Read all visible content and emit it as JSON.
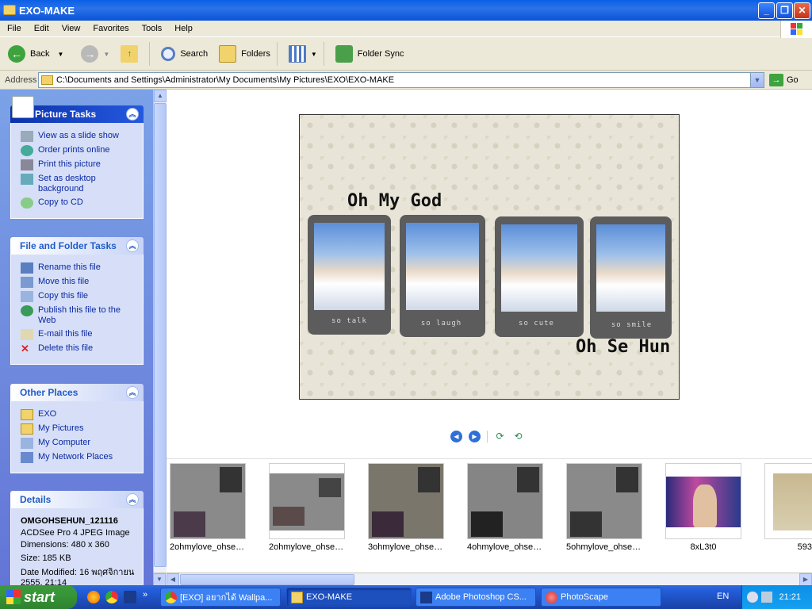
{
  "window": {
    "title": "EXO-MAKE"
  },
  "menu": [
    "File",
    "Edit",
    "View",
    "Favorites",
    "Tools",
    "Help"
  ],
  "toolbar": {
    "back": "Back",
    "search": "Search",
    "folders": "Folders",
    "folder_sync": "Folder Sync"
  },
  "address": {
    "label": "Address",
    "path": "C:\\Documents and Settings\\Administrator\\My Documents\\My Pictures\\EXO\\EXO-MAKE",
    "go": "Go"
  },
  "picture_tasks": {
    "title": "Picture Tasks",
    "items": [
      "View as a slide show",
      "Order prints online",
      "Print this picture",
      "Set as desktop background",
      "Copy to CD"
    ]
  },
  "file_tasks": {
    "title": "File and Folder Tasks",
    "items": [
      "Rename this file",
      "Move this file",
      "Copy this file",
      "Publish this file to the Web",
      "E-mail this file",
      "Delete this file"
    ]
  },
  "other_places": {
    "title": "Other Places",
    "items": [
      "EXO",
      "My Pictures",
      "My Computer",
      "My Network Places"
    ]
  },
  "details": {
    "title": "Details",
    "name": "OMGOHSEHUN_121116",
    "type": "ACDSee Pro 4 JPEG Image",
    "dimensions": "Dimensions: 480 x 360",
    "size": "Size: 185 KB",
    "modified": "Date Modified: 16 พฤศจิกายน 2555, 21:14"
  },
  "preview": {
    "heading": "Oh My God",
    "subtitle": "Oh Se Hun",
    "captions": [
      "so talk",
      "so laugh",
      "so cute",
      "so smile"
    ]
  },
  "filmstrip": [
    "2ohmylove_ohsehun1...",
    "2ohmylove_ohsehun1...",
    "3ohmylove_ohsehun1...",
    "4ohmylove_ohsehun1...",
    "5ohmylove_ohsehun1...",
    "8xL3t0",
    "593"
  ],
  "taskbar": {
    "start": "start",
    "tasks": [
      "[EXO] อยากได้ Wallpa...",
      "EXO-MAKE",
      "Adobe Photoshop CS...",
      "PhotoScape"
    ],
    "lang": "EN",
    "clock": "21:21"
  },
  "colors": {
    "accent": "#0b53d8",
    "link": "#0b28a4",
    "start": "#379537"
  }
}
